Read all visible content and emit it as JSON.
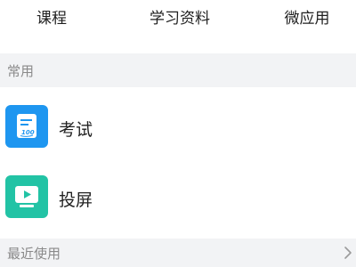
{
  "top_tabs": {
    "course": "课程",
    "study_materials": "学习资料",
    "micro_apps": "微应用"
  },
  "sections": {
    "common": {
      "title": "常用",
      "items": [
        {
          "label": "考试",
          "icon": "exam-icon",
          "color": "#1e96f0"
        },
        {
          "label": "投屏",
          "icon": "screen-cast-icon",
          "color": "#22c3a5"
        }
      ]
    },
    "recent": {
      "title": "最近使用",
      "icon": "chevron-right-icon"
    }
  },
  "colors": {
    "section_bg": "#f2f3f5",
    "section_text": "#8a8a8a",
    "exam_blue": "#1e96f0",
    "cast_teal": "#22c3a5"
  }
}
